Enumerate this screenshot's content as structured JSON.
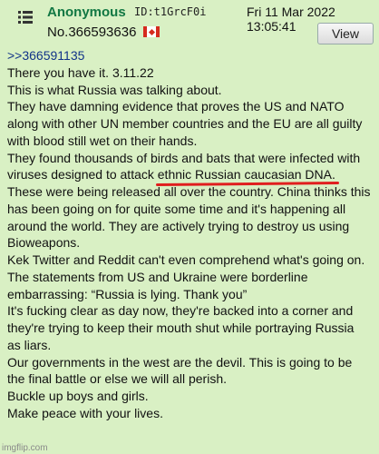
{
  "header": {
    "poster_name": "Anonymous",
    "poster_id": "ID:t1GrcF0i",
    "datetime": "Fri 11 Mar 2022 13:05:41",
    "post_number": "No.366593636",
    "view_label": "View",
    "menu_icon": "hamburger-list-icon",
    "flag_icon": "canada-flag-icon"
  },
  "post": {
    "quote_link": ">>366591135",
    "lines": [
      "There you have it. 3.11.22",
      "This is what Russia was talking about.",
      "They have damning evidence that proves the US and NATO",
      "along with other UN member countries and the EU are all guilty",
      "with blood still wet on their hands.",
      "They found thousands of birds and bats that were infected with",
      "viruses designed to attack ",
      "These were being released all over the country. China thinks this",
      "has been going on for quite some time and it's happening all",
      "around the world. They are actively trying to destroy us using",
      "Bioweapons.",
      "Kek Twitter and Reddit can't even comprehend what's going on.",
      "The statements from US and Ukraine were borderline",
      "embarrassing: “Russia is lying. Thank you”",
      "It's fucking clear as day now, they're backed into a corner and",
      "they're trying to keep their mouth shut while portraying Russia",
      "as liars.",
      "Our governments in the west are the devil. This is going to be",
      "the final battle or else we will all perish.",
      "Buckle up boys and girls.",
      "Make peace with your lives."
    ],
    "underlined_phrase": "ethnic Russian caucasian DNA."
  },
  "watermark": "imgflip.com",
  "colors": {
    "background": "#d9f0c4",
    "poster_name": "#117743",
    "quote_link": "#113388",
    "underline_mark": "#e01e1e"
  }
}
